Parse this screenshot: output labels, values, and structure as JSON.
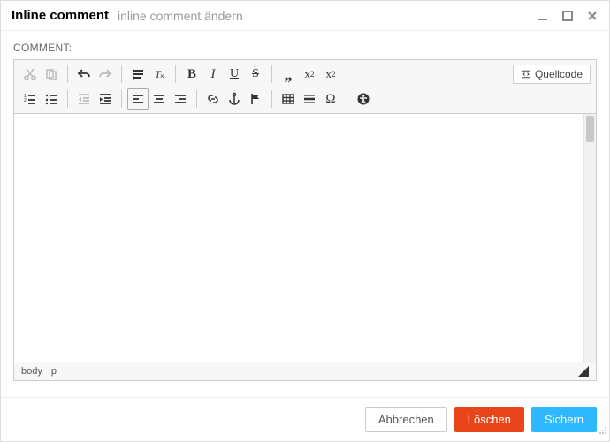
{
  "header": {
    "title": "Inline comment",
    "subtitle": "inline comment ändern"
  },
  "field_label": "COMMENT:",
  "source_button": "Quellcode",
  "toolbar": {
    "cut": "cut",
    "copy": "copy",
    "undo": "undo",
    "redo": "redo",
    "format": "format",
    "removeformat": "remove-format",
    "bold": "B",
    "italic": "I",
    "underline": "U",
    "strike": "S",
    "quote": "„",
    "sub_x": "x",
    "sub_2": "2",
    "sup_x": "x",
    "sup_2": "2",
    "numlist": "numlist",
    "bullist": "bullist",
    "outdent": "outdent",
    "indent": "indent",
    "alignleft": "left",
    "aligncenter": "center",
    "alignright": "right",
    "link": "link",
    "anchor": "anchor",
    "flag": "flag",
    "table": "table",
    "hr": "hr",
    "omega": "Ω",
    "accessibility": "a11y"
  },
  "path": {
    "body": "body",
    "p": "p"
  },
  "footer": {
    "cancel": "Abbrechen",
    "delete": "Löschen",
    "save": "Sichern"
  }
}
